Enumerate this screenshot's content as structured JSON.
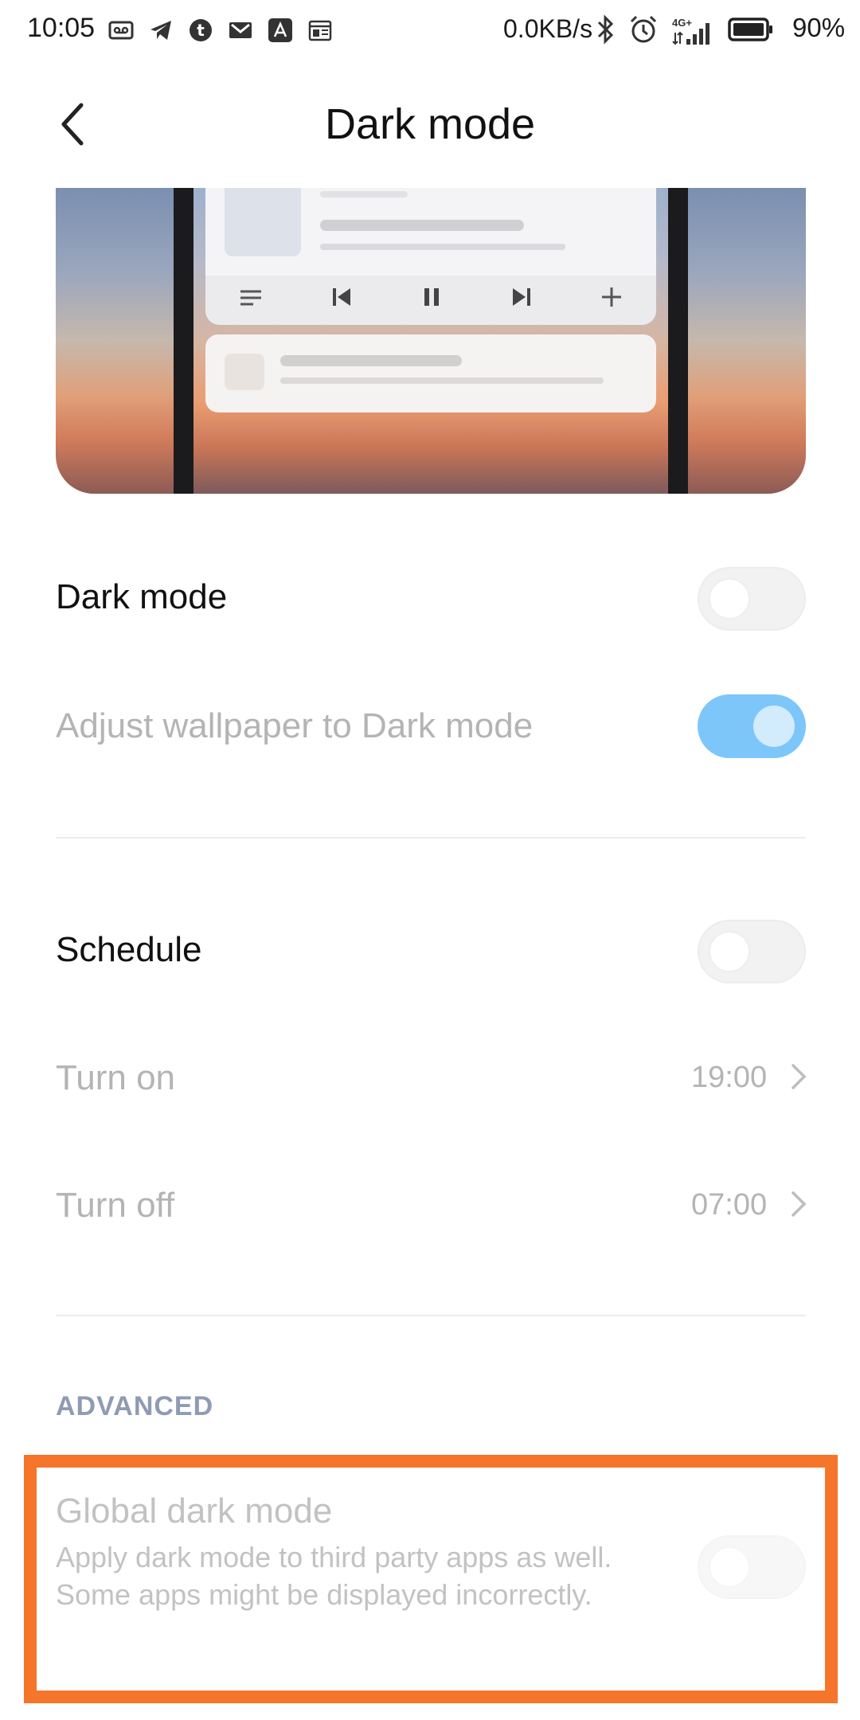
{
  "status_bar": {
    "time": "10:05",
    "network_speed": "0.0KB/s",
    "network_type": "4G+",
    "battery_percent": "90%",
    "left_icons": [
      "voicemail-icon",
      "telegram-icon",
      "tumblr-icon",
      "gmail-icon",
      "app-icon",
      "calendar-icon"
    ],
    "right_icons": [
      "bluetooth-icon",
      "alarm-icon",
      "signal-icon",
      "battery-icon"
    ]
  },
  "header": {
    "title": "Dark mode",
    "back_icon": "chevron-left-icon"
  },
  "settings": {
    "dark_mode": {
      "label": "Dark mode",
      "enabled": false
    },
    "adjust_wallpaper": {
      "label": "Adjust wallpaper to Dark mode",
      "enabled": true
    },
    "schedule": {
      "label": "Schedule",
      "enabled": false
    },
    "turn_on": {
      "label": "Turn on",
      "value": "19:00"
    },
    "turn_off": {
      "label": "Turn off",
      "value": "07:00"
    }
  },
  "advanced": {
    "section_label": "ADVANCED",
    "global_dark_mode": {
      "label": "Global dark mode",
      "description": "Apply dark mode to third party apps as well. Some apps might be displayed incorrectly.",
      "enabled": false
    }
  },
  "colors": {
    "toggle_on": "#7cc6fa",
    "highlight": "#f5752a",
    "section_header": "#8f9bb3"
  }
}
